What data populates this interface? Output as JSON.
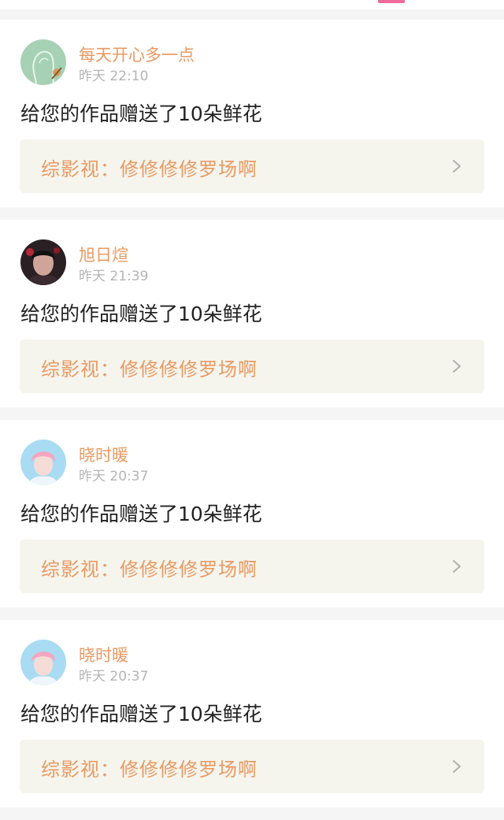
{
  "notifications": [
    {
      "user": "每天开心多一点",
      "time": "昨天 22:10",
      "message": "给您的作品赠送了10朵鲜花",
      "work": "综影视：修修修修罗场啊",
      "avatar_icon": "avatar-sketch"
    },
    {
      "user": "旭日煊",
      "time": "昨天 21:39",
      "message": "给您的作品赠送了10朵鲜花",
      "work": "综影视：修修修修罗场啊",
      "avatar_icon": "avatar-dark-portrait"
    },
    {
      "user": "晓时暖",
      "time": "昨天 20:37",
      "message": "给您的作品赠送了10朵鲜花",
      "work": "综影视：修修修修罗场啊",
      "avatar_icon": "avatar-pink-portrait"
    },
    {
      "user": "晓时暖",
      "time": "昨天 20:37",
      "message": "给您的作品赠送了10朵鲜花",
      "work": "综影视：修修修修罗场啊",
      "avatar_icon": "avatar-pink-portrait"
    }
  ],
  "colors": {
    "accent": "#e99a62",
    "tab_indicator": "#f06a9a",
    "link_bg": "#f5f5ee"
  }
}
